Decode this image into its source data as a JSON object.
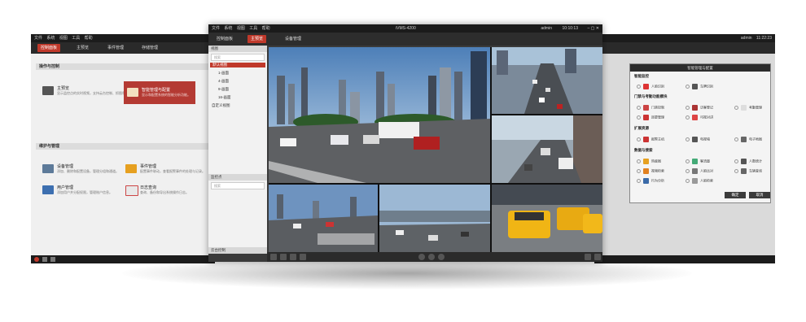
{
  "left_window": {
    "menu": [
      "文件",
      "系统",
      "视图",
      "工具",
      "帮助"
    ],
    "tabs": [
      "控制面板",
      "主预览",
      "事件管理",
      "存储管理"
    ],
    "section1_title": "操作与控制",
    "items1": [
      {
        "title": "主预览",
        "desc": "显示监控点的实时视频，支持云台控制、抓图和录像等功能。"
      },
      {
        "title": "智能管理与配置",
        "desc": "显示和配置系统的智能分析功能。"
      }
    ],
    "section2_title": "维护与管理",
    "items2": [
      {
        "title": "设备管理",
        "desc": "添加、删除和配置设备，管理分组和通道。"
      },
      {
        "title": "事件管理",
        "desc": "配置事件联动，查看报警事件的处理与记录。"
      },
      {
        "title": "用户管理",
        "desc": "添加用户并分配权限，管理账户信息。"
      },
      {
        "title": "日志查询",
        "desc": "查询、备份和导出系统操作日志。"
      }
    ]
  },
  "center_window": {
    "menu": [
      "文件",
      "系统",
      "视图",
      "工具",
      "帮助"
    ],
    "title": "iVMS-4200",
    "user": "admin",
    "time": "10:10:13",
    "tabs": [
      "控制面板",
      "主预览",
      "设备管理"
    ],
    "panel1_title": "视图",
    "search_placeholder": "搜索",
    "tree": [
      "默认视图",
      "1-画面",
      "4-画面",
      "9-画面",
      "16-画面",
      "自定义视图"
    ],
    "panel2_title": "监控点",
    "panel2_search": "搜索",
    "panel3_title": "云台控制"
  },
  "right_window": {
    "user": "admin",
    "time": "11:22:23",
    "dialog_title": "智能管理与配置",
    "sections": [
      {
        "title": "智能监控",
        "options": [
          "人脸识别",
          "车牌识别"
        ]
      },
      {
        "title": "门禁与考勤功能模块",
        "options": [
          "门禁控制",
          "访客登记",
          "考勤管理",
          "巡更管理",
          "可视对讲"
        ]
      },
      {
        "title": "扩展资源",
        "options": [
          "报警主机",
          "电视墙",
          "电子地图"
        ]
      },
      {
        "title": "数据与搜索",
        "options": [
          "热度图",
          "客流量",
          "人数统计",
          "视频检索",
          "人脸比对",
          "车辆查询",
          "行为分析",
          "人脸检索"
        ]
      }
    ],
    "ok_label": "确定",
    "cancel_label": "取消"
  },
  "colors": {
    "accent": "#c0392b",
    "titlebar": "#1c1c1c",
    "panel": "#f0f0f0"
  }
}
